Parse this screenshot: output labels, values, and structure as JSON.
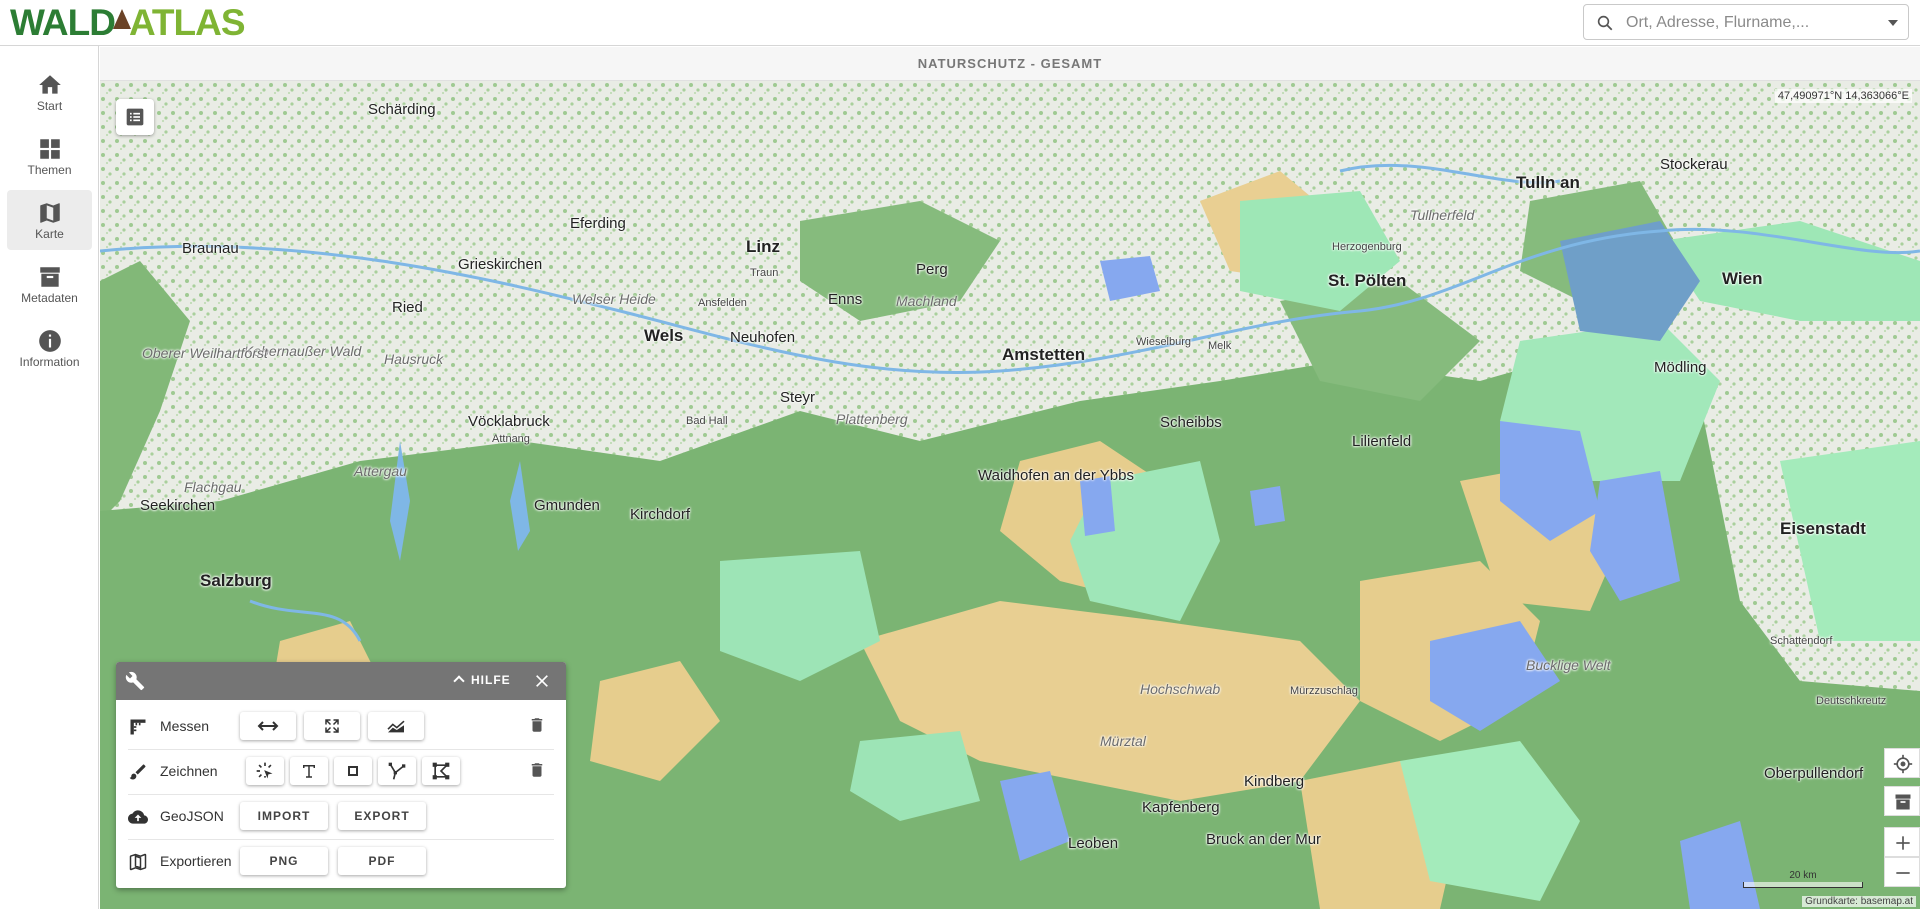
{
  "app": {
    "logo_part1": "WALD",
    "logo_part2": "ATLAS"
  },
  "search": {
    "placeholder": "Ort, Adresse, Flurname,...",
    "icon": "search-icon"
  },
  "nav": [
    {
      "label": "Start",
      "icon": "home-icon",
      "active": false
    },
    {
      "label": "Themen",
      "icon": "grid-icon",
      "active": false
    },
    {
      "label": "Karte",
      "icon": "map-icon",
      "active": true
    },
    {
      "label": "Metadaten",
      "icon": "archive-icon",
      "active": false
    },
    {
      "label": "Information",
      "icon": "info-icon",
      "active": false
    }
  ],
  "map": {
    "title": "NATURSCHUTZ - GESAMT",
    "coordinates": "47,490971°N 14,363066°E",
    "scale_label": "20 km",
    "attribution": "Grundkarte: basemap.at",
    "places_major": [
      "Linz",
      "Wien",
      "St. Pölten",
      "Salzburg",
      "Steyr",
      "Wels",
      "Amstetten",
      "Leoben",
      "Gmunden"
    ],
    "places_minor": [
      "Schärding",
      "Braunau",
      "Ried",
      "Grieskirchen",
      "Eferding",
      "Perg",
      "Enns",
      "Tulln an",
      "Stockerau",
      "Vöcklabruck",
      "Kirchdorf",
      "Scheibbs",
      "Lilienfeld",
      "Mödling",
      "Kindberg",
      "Kapfenberg",
      "Bruck an der Mur",
      "Waidhofen an der Ybbs",
      "Traun",
      "Neuhofen",
      "Melk",
      "Wieselburg",
      "Attnang",
      "Seekirchen",
      "Schattendorf",
      "Oberpullendorf",
      "Deutschkreutz",
      "Eisenstadt",
      "Mürzzuschlag",
      "Bad Hall",
      "Herzogenburg",
      "Ansfelden",
      "Amstetten"
    ],
    "regions": [
      "Hausruck",
      "Welser Heide",
      "Machland",
      "Kobernaußer Wald",
      "Attergau",
      "Oberer Weilhartforst",
      "Tullnerfeld",
      "Bucklige Welt",
      "Mürztal",
      "Hochschwab",
      "Flachgau",
      "Plattenberg"
    ]
  },
  "tools": {
    "help_label": "HILFE",
    "rows": [
      {
        "label": "Messen",
        "icon": "ruler-icon"
      },
      {
        "label": "Zeichnen",
        "icon": "brush-icon"
      },
      {
        "label": "GeoJSON",
        "icon": "cloud-upload-icon"
      },
      {
        "label": "Exportieren",
        "icon": "map-icon"
      }
    ],
    "import_label": "IMPORT",
    "export_label": "EXPORT",
    "png_label": "PNG",
    "pdf_label": "PDF"
  },
  "colors": {
    "forest": "#7fb77a",
    "nature_reserve": "#9ee7b6",
    "landscape_protection": "#e9cf8f",
    "natura2000": "#8aa8ef",
    "accent": "#2c7d34"
  }
}
